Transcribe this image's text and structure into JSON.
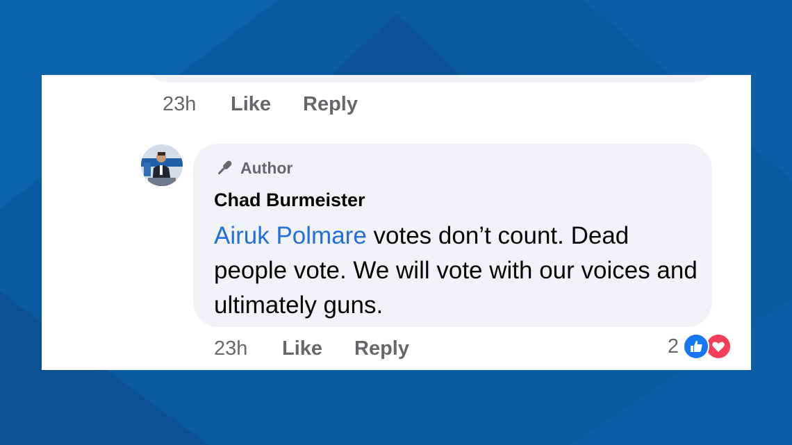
{
  "previous_comment": {
    "actions": {
      "time": "23h",
      "like_label": "Like",
      "reply_label": "Reply"
    }
  },
  "comment": {
    "badge_label": "Author",
    "author_name": "Chad Burmeister",
    "mention": "Airuk Polmare",
    "text": " votes don’t count. Dead people vote. We will vote with our voices and ultimately guns.",
    "actions": {
      "time": "23h",
      "like_label": "Like",
      "reply_label": "Reply"
    },
    "reactions": {
      "count": "2",
      "icons": [
        "like-icon",
        "love-icon"
      ]
    }
  },
  "colors": {
    "bubble_bg": "#f0f2f5",
    "mention": "#216fdb",
    "muted_text": "#65676b",
    "like_blue": "#1877f2",
    "love_red": "#f33e58"
  }
}
